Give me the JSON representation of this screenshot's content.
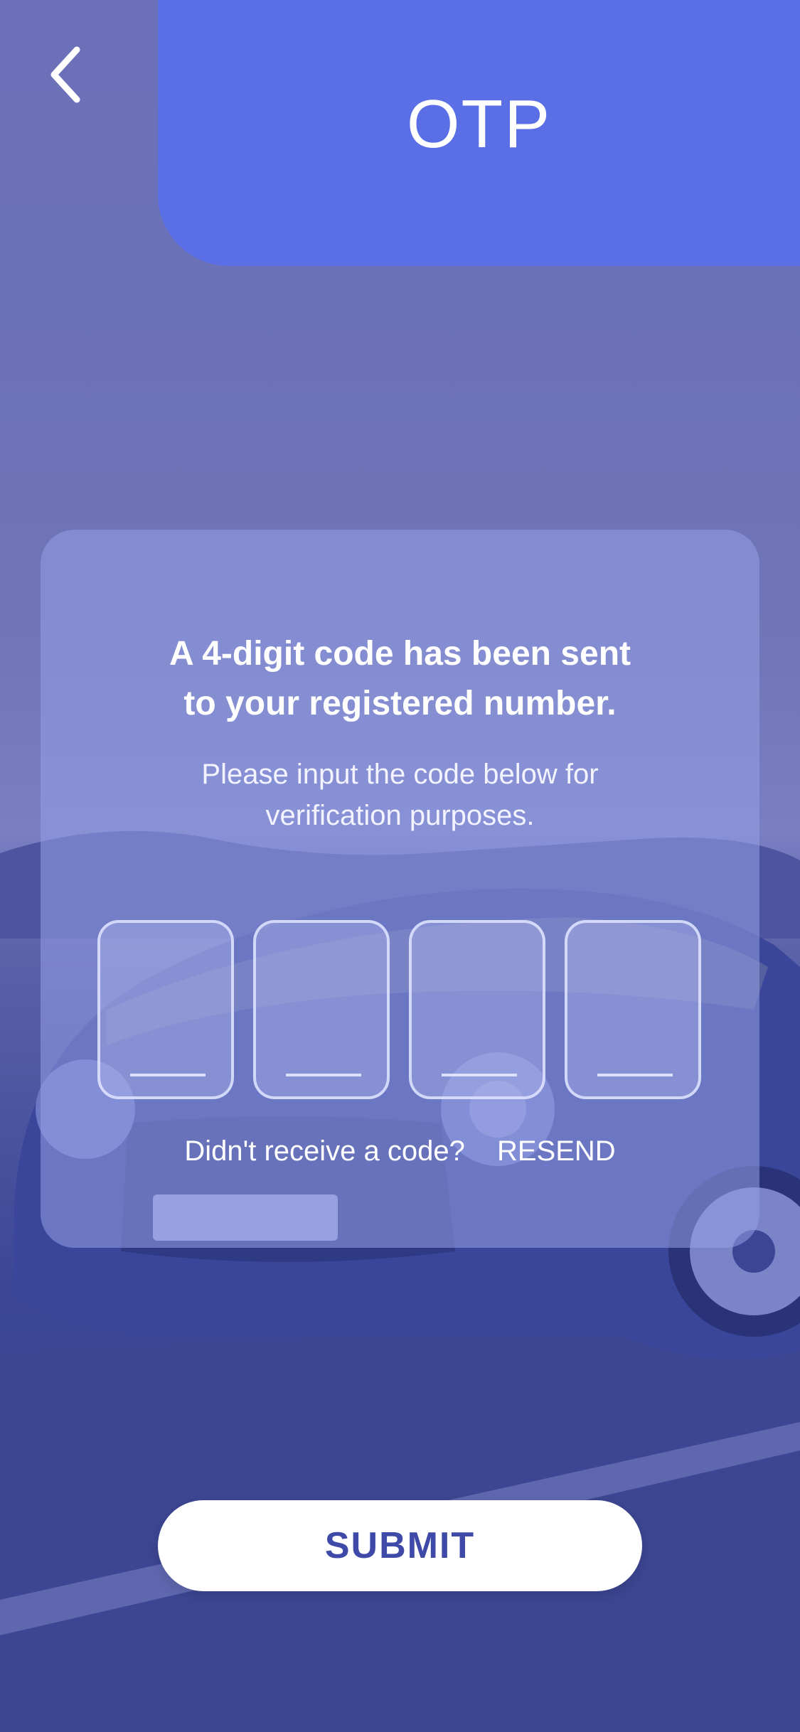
{
  "header": {
    "title": "OTP",
    "back_icon": "chevron-left-icon"
  },
  "card": {
    "heading_line1": "A 4-digit code has been sent",
    "heading_line2": "to your registered number.",
    "subtext_line1": "Please input the code below for",
    "subtext_line2": "verification purposes.",
    "otp_digits": [
      "",
      "",
      "",
      ""
    ],
    "resend_prompt": "Didn't receive a code?",
    "resend_label": "RESEND"
  },
  "submit_label": "SUBMIT",
  "colors": {
    "header_bg": "#5a6ee6",
    "overlay_tint": "#5a63b8",
    "submit_text": "#3f4aa8"
  }
}
